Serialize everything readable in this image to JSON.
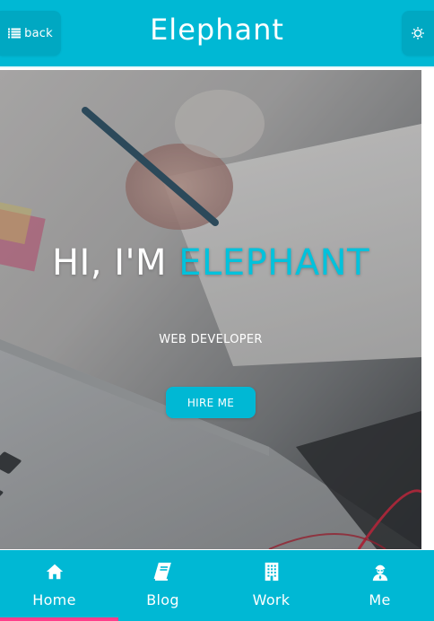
{
  "header": {
    "back_label": "back",
    "title": "Elephant",
    "back_icon": "list-icon",
    "settings_icon": "gear-icon"
  },
  "hero": {
    "title_prefix": "HI, I'M ",
    "title_accent": "ELEPHANT",
    "subtitle": "WEB DEVELOPER",
    "cta_label": "HIRE ME"
  },
  "bottom_nav": {
    "active_index": 0,
    "items": [
      {
        "label": "Home",
        "icon": "home-icon"
      },
      {
        "label": "Blog",
        "icon": "book-icon"
      },
      {
        "label": "Work",
        "icon": "building-icon"
      },
      {
        "label": "Me",
        "icon": "user-icon"
      }
    ]
  },
  "colors": {
    "primary": "#00b8d4",
    "accent_text": "#00c2dc",
    "active_indicator": "#ff3d8a"
  }
}
